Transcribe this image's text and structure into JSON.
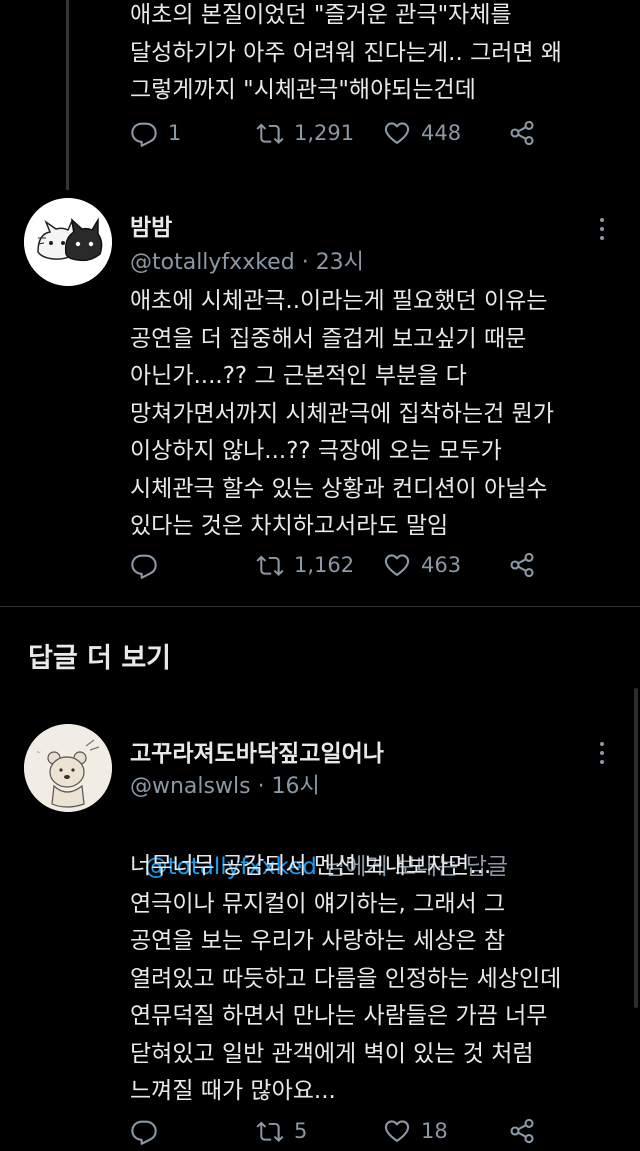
{
  "top_tweet": {
    "text": "애초의 본질이었던 \"즐거운 관극\"자체를\n달성하기가 아주 어려워 진다는게.. 그러면 왜\n그렇게까지 \"시체관극\"해야되는건데",
    "actions": {
      "reply_count": "1",
      "retweet_count": "1,291",
      "like_count": "448"
    }
  },
  "tweet2": {
    "name": "밤밤",
    "handle": "@totallyfxxked",
    "separator": "·",
    "time": "23시",
    "text": "애초에 시체관극..이라는게 필요했던 이유는\n공연을 더 집중해서 즐겁게 보고싶기 때문\n아닌가....?? 그 근본적인 부분을 다\n망쳐가면서까지 시체관극에 집착하는건 뭔가\n이상하지 않나...?? 극장에 오는 모두가\n시체관극 할수 있는 상황과 컨디션이 아닐수\n있다는 것은 차치하고서라도 말임",
    "actions": {
      "retweet_count": "1,162",
      "like_count": "463"
    }
  },
  "more_replies": {
    "label": "답글 더 보기"
  },
  "tweet3": {
    "name": "고꾸라져도바닥짚고일어나",
    "handle": "@wnalswls",
    "separator": "·",
    "time": "16시",
    "reply_to_handle": "@totallyfxxked",
    "reply_to_suffix": " 님에게 보내는 답글",
    "text": "너무너무 공감되서 멘션 보내보자면...\n연극이나 뮤지컬이 얘기하는, 그래서 그\n공연을 보는 우리가 사랑하는 세상은 참\n열려있고 따듯하고 다름을 인정하는 세상인데\n연뮤덕질 하면서 만나는 사람들은 가끔 너무\n닫혀있고 일반 관객에게 벽이 있는 것 처럼\n느껴질 때가 많아요...",
    "actions": {
      "retweet_count": "5",
      "like_count": "18"
    }
  },
  "icons": {
    "reply": "reply-icon",
    "retweet": "retweet-icon",
    "like": "like-icon",
    "share": "share-icon",
    "more": "more-icon"
  },
  "colors": {
    "background": "#000000",
    "text": "#e7e9ea",
    "secondary": "#8b98a5",
    "link": "#1d9bf0",
    "divider": "#2f3336"
  }
}
